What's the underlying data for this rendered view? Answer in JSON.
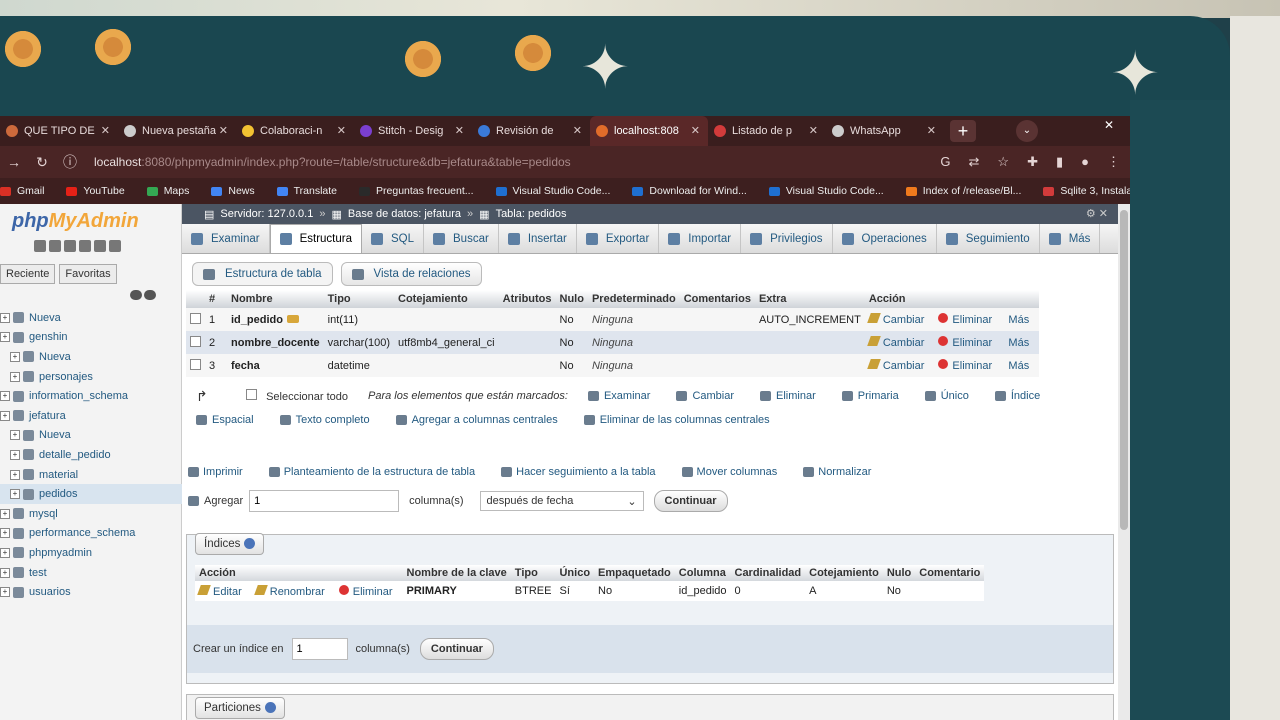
{
  "browser": {
    "tabs": [
      {
        "label": "QUE TIPO DE",
        "icon_color": "#cc6a3c"
      },
      {
        "label": "Nueva pestaña",
        "icon_color": "#cccccc"
      },
      {
        "label": "Colaboraci-n",
        "icon_color": "#f2c232"
      },
      {
        "label": "Stitch - Desig",
        "icon_color": "#7b3fd0"
      },
      {
        "label": "Revisión de",
        "icon_color": "#3a7ad8"
      },
      {
        "label": "localhost:808",
        "icon_color": "#e16c2a",
        "active": true
      },
      {
        "label": "Listado de p",
        "icon_color": "#d23b3b"
      },
      {
        "label": "WhatsApp",
        "icon_color": "#cccccc"
      }
    ],
    "url_host": "localhost",
    "url_port": ":8080",
    "url_path": "/phpmyadmin/index.php?route=/table/structure&db=jefatura&table=pedidos",
    "bookmarks": [
      {
        "label": "Gmail",
        "color": "#d93025"
      },
      {
        "label": "YouTube",
        "color": "#e62117"
      },
      {
        "label": "Maps",
        "color": "#34a853"
      },
      {
        "label": "News",
        "color": "#4285f4"
      },
      {
        "label": "Translate",
        "color": "#4285f4"
      },
      {
        "label": "Preguntas frecuent...",
        "color": "#2a2a2a"
      },
      {
        "label": "Visual Studio Code...",
        "color": "#1f6fd1"
      },
      {
        "label": "Download for Wind...",
        "color": "#1f6fd1"
      },
      {
        "label": "Visual Studio Code...",
        "color": "#1f6fd1"
      },
      {
        "label": "Index of /release/Bl...",
        "color": "#f07a1d"
      },
      {
        "label": "Sqlite 3, Instalación...",
        "color": "#d23b3b"
      }
    ]
  },
  "sidebar": {
    "logo_php": "php",
    "logo_myadmin": "MyAdmin",
    "tabs": [
      "Reciente",
      "Favoritas"
    ],
    "tree": [
      {
        "label": "Nueva",
        "level": "l0"
      },
      {
        "label": "genshin",
        "level": "l0"
      },
      {
        "label": "Nueva",
        "level": "l1"
      },
      {
        "label": "personajes",
        "level": "l1"
      },
      {
        "label": "information_schema",
        "level": "l0"
      },
      {
        "label": "jefatura",
        "level": "l0"
      },
      {
        "label": "Nueva",
        "level": "l1"
      },
      {
        "label": "detalle_pedido",
        "level": "l1"
      },
      {
        "label": "material",
        "level": "l1"
      },
      {
        "label": "pedidos",
        "level": "l1",
        "selected": true
      },
      {
        "label": "mysql",
        "level": "l0"
      },
      {
        "label": "performance_schema",
        "level": "l0"
      },
      {
        "label": "phpmyadmin",
        "level": "l0"
      },
      {
        "label": "test",
        "level": "l0"
      },
      {
        "label": "usuarios",
        "level": "l0"
      }
    ]
  },
  "breadcrumb": {
    "server": "Servidor: 127.0.0.1",
    "database": "Base de datos: jefatura",
    "table": "Tabla: pedidos"
  },
  "menu": [
    "Examinar",
    "Estructura",
    "SQL",
    "Buscar",
    "Insertar",
    "Exportar",
    "Importar",
    "Privilegios",
    "Operaciones",
    "Seguimiento",
    "Más"
  ],
  "subtabs": [
    "Estructura de tabla",
    "Vista de relaciones"
  ],
  "structure": {
    "headers": [
      "#",
      "Nombre",
      "Tipo",
      "Cotejamiento",
      "Atributos",
      "Nulo",
      "Predeterminado",
      "Comentarios",
      "Extra",
      "Acción"
    ],
    "rows": [
      {
        "num": "1",
        "name": "id_pedido",
        "type": "int(11)",
        "collation": "",
        "attributes": "",
        "null": "No",
        "default": "Ninguna",
        "comments": "",
        "extra": "AUTO_INCREMENT",
        "key": true
      },
      {
        "num": "2",
        "name": "nombre_docente",
        "type": "varchar(100)",
        "collation": "utf8mb4_general_ci",
        "attributes": "",
        "null": "No",
        "default": "Ninguna",
        "comments": "",
        "extra": ""
      },
      {
        "num": "3",
        "name": "fecha",
        "type": "datetime",
        "collation": "",
        "attributes": "",
        "null": "No",
        "default": "Ninguna",
        "comments": "",
        "extra": ""
      }
    ],
    "actions": [
      "Cambiar",
      "Eliminar",
      "Más"
    ]
  },
  "bulk": {
    "select_all": "Seleccionar todo",
    "marked": "Para los elementos que están marcados:",
    "actions_row1": [
      "Examinar",
      "Cambiar",
      "Eliminar",
      "Primaria",
      "Único",
      "Índice"
    ],
    "actions_row2": [
      "Espacial",
      "Texto completo",
      "Agregar a columnas centrales",
      "Eliminar de las columnas centrales"
    ]
  },
  "tools": [
    "Imprimir",
    "Planteamiento de la estructura de tabla",
    "Hacer seguimiento a la tabla",
    "Mover columnas",
    "Normalizar"
  ],
  "add_column": {
    "label": "Agregar",
    "value": "1",
    "suffix": "columna(s)",
    "position": "después de fecha",
    "button": "Continuar"
  },
  "indexes": {
    "title": "Índices",
    "headers": [
      "Acción",
      "Nombre de la clave",
      "Tipo",
      "Único",
      "Empaquetado",
      "Columna",
      "Cardinalidad",
      "Cotejamiento",
      "Nulo",
      "Comentario"
    ],
    "row": {
      "edit": "Editar",
      "rename": "Renombrar",
      "delete": "Eliminar",
      "key_name": "PRIMARY",
      "type": "BTREE",
      "unique": "Sí",
      "packed": "No",
      "column": "id_pedido",
      "cardinality": "0",
      "collation": "A",
      "null": "No",
      "comment": ""
    },
    "create_label": "Crear un índice en",
    "create_value": "1",
    "create_suffix": "columna(s)",
    "create_button": "Continuar"
  },
  "partitions": {
    "title": "Particiones"
  }
}
